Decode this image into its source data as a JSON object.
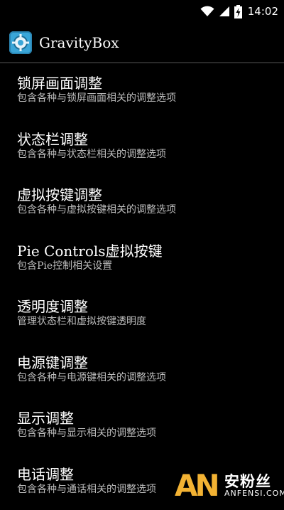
{
  "status_bar": {
    "time": "14:02",
    "icons": [
      "wifi-icon",
      "signal-icon",
      "battery-charging-icon"
    ]
  },
  "action_bar": {
    "app_icon": "gravitybox-app-icon",
    "title": "GravityBox"
  },
  "items": [
    {
      "title": "锁屏画面调整",
      "subtitle": "包含各种与锁屏画面相关的调整选项"
    },
    {
      "title": "状态栏调整",
      "subtitle": "包含各种与状态栏相关的调整选项"
    },
    {
      "title": "虚拟按键调整",
      "subtitle": "包含各种与虚拟按键相关的调整选项"
    },
    {
      "title": "Pie Controls虚拟按键",
      "subtitle": "包含Pie控制相关设置"
    },
    {
      "title": "透明度调整",
      "subtitle": "管理状态栏和虚拟按键透明度"
    },
    {
      "title": "电源键调整",
      "subtitle": "包含各种与电源键相关的调整选项"
    },
    {
      "title": "显示调整",
      "subtitle": "包含各种与显示相关的调整选项"
    },
    {
      "title": "电话调整",
      "subtitle": "包含各种与通话相关的调整选项"
    }
  ],
  "watermark": {
    "logo_letters": "AN",
    "cn": "安粉丝",
    "en": "ANFENSI.COM"
  },
  "colors": {
    "background": "#000000",
    "accent": "#3aa6d8",
    "subtitle": "#bdbdbd",
    "watermark_accent": "#f2b233"
  }
}
